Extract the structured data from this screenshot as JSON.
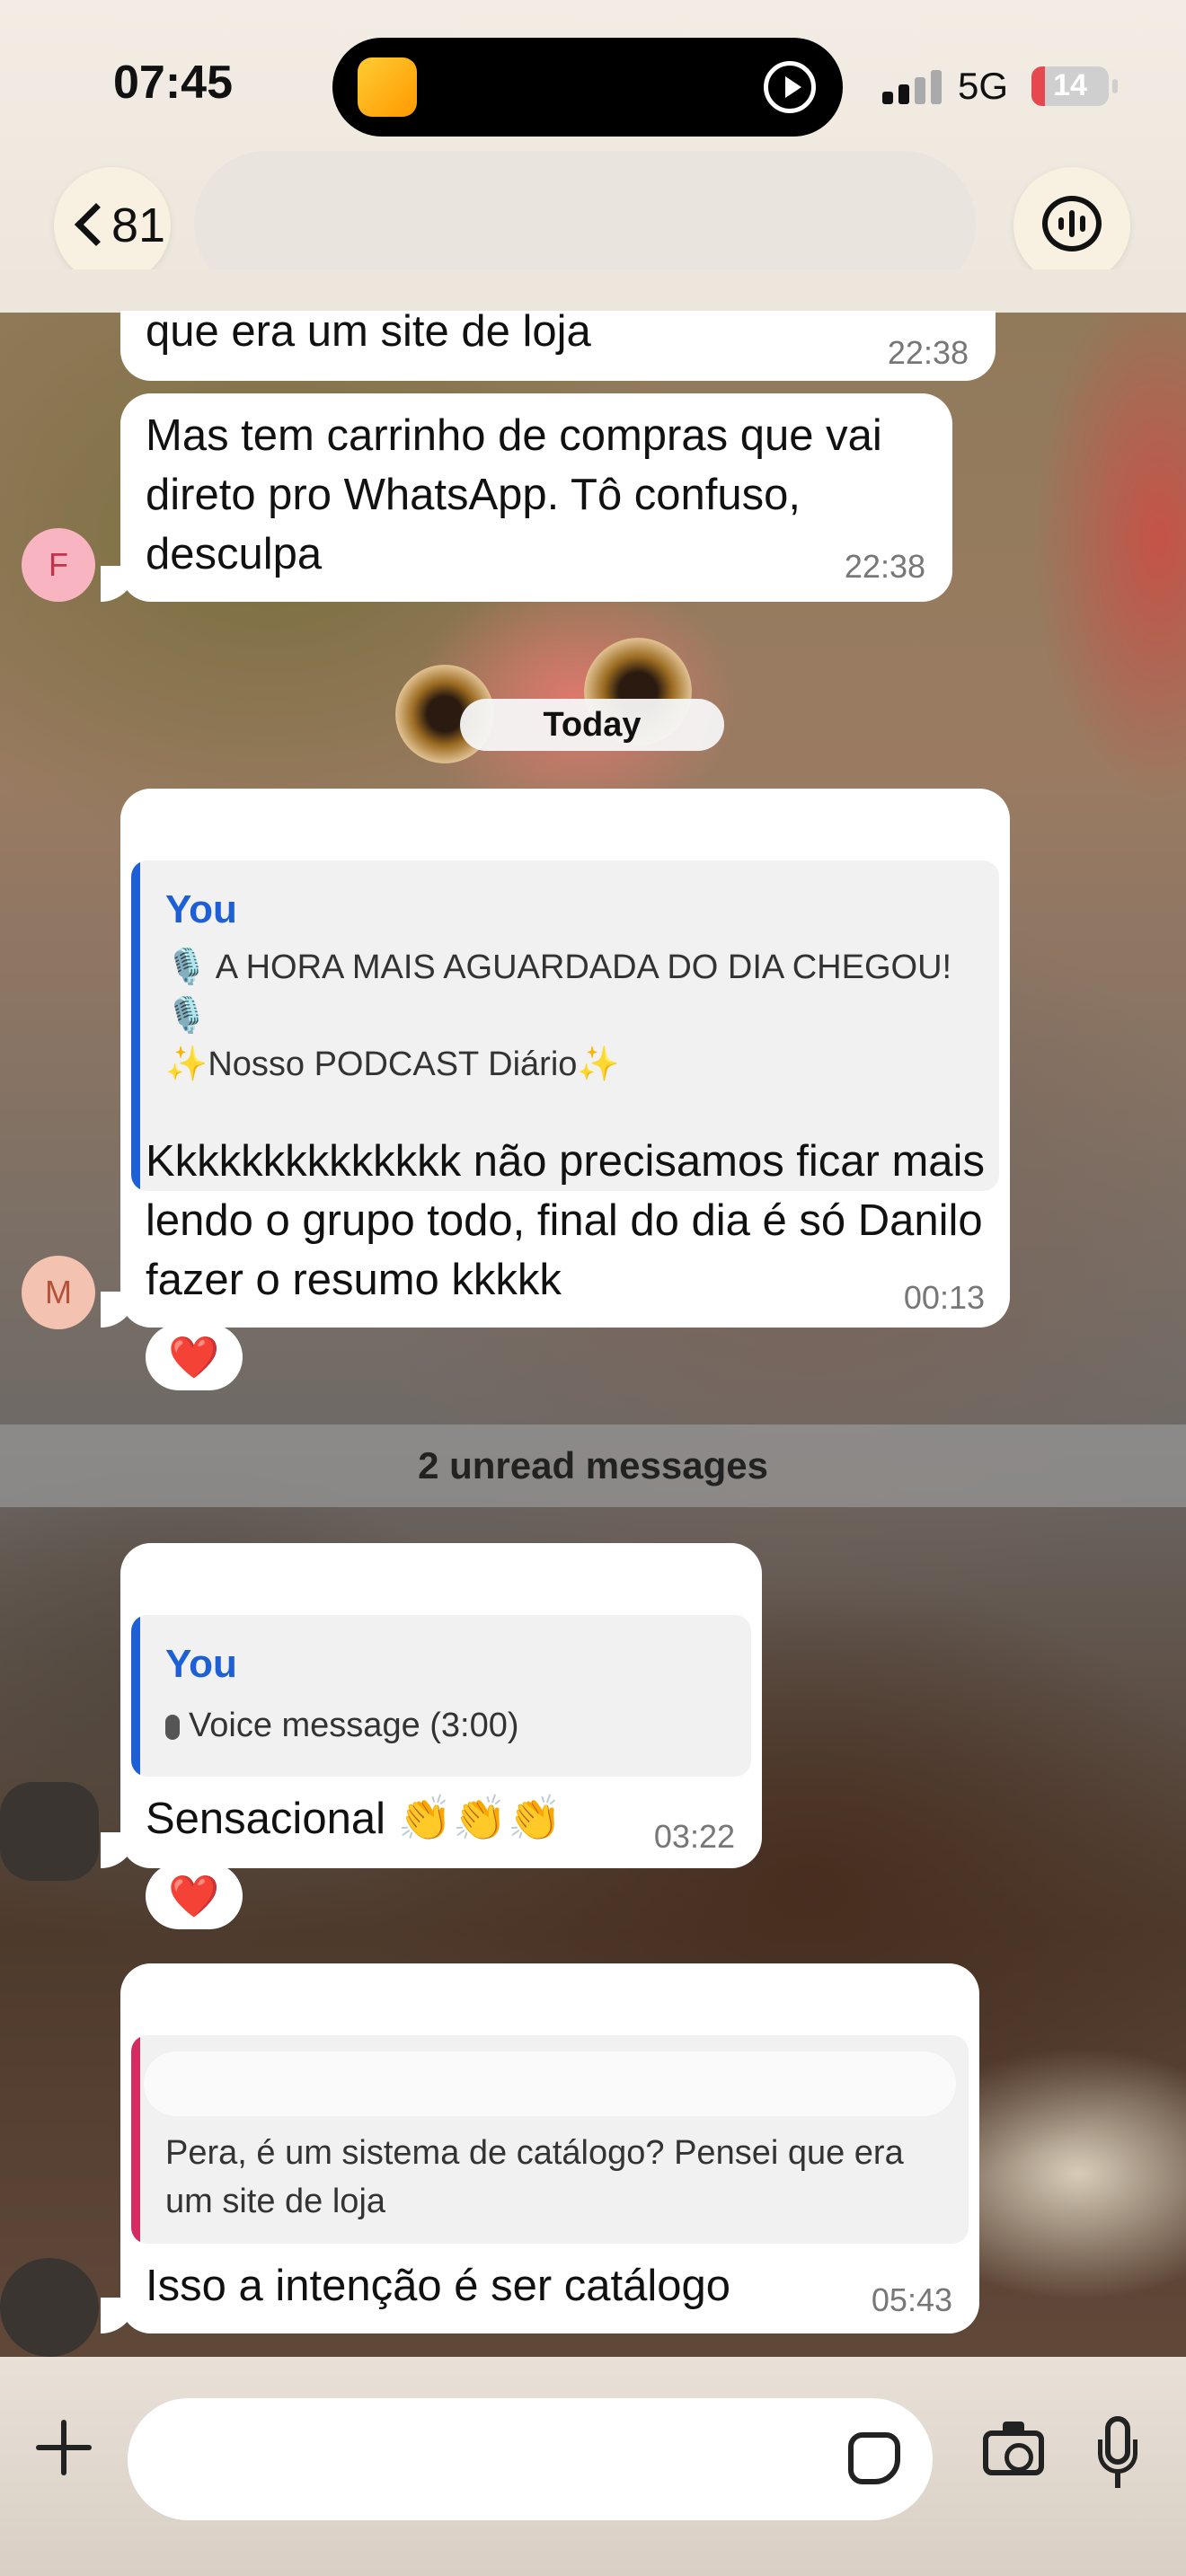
{
  "status_bar": {
    "time": "07:45",
    "network": "5G",
    "battery": "14"
  },
  "header": {
    "back_count": "81"
  },
  "messages": [
    {
      "text": "que era um site de loja",
      "time": "22:38"
    },
    {
      "text": "Mas tem carrinho de compras que vai direto pro WhatsApp. Tô confuso, desculpa",
      "time": "22:38",
      "avatar": "F"
    },
    {
      "quote_author": "You",
      "quote_line1": "🎙️ A HORA MAIS AGUARDADA DO DIA CHEGOU! 🎙️",
      "quote_line2": "✨Nosso PODCAST Diário✨",
      "text": "Kkkkkkkkkkkkkk não precisamos ficar mais lendo o grupo  todo, final do dia é só Danilo fazer o resumo kkkkk",
      "time": "00:13",
      "avatar": "M",
      "reaction": "❤️"
    },
    {
      "quote_author": "You",
      "quote_text": "Voice message (3:00)",
      "text": "Sensacional 👏👏👏",
      "time": "03:22",
      "reaction": "❤️"
    },
    {
      "quote_text": "Pera, é um sistema de catálogo? Pensei que era um site de loja",
      "text": "Isso a intenção é ser catálogo",
      "time": "05:43"
    }
  ],
  "date_separator": "Today",
  "unread_banner": "2 unread messages",
  "colors": {
    "quote_bar_you": "#1f5fd6",
    "quote_bar_other": "#d12d63",
    "reaction_heart": "#e0102a"
  }
}
